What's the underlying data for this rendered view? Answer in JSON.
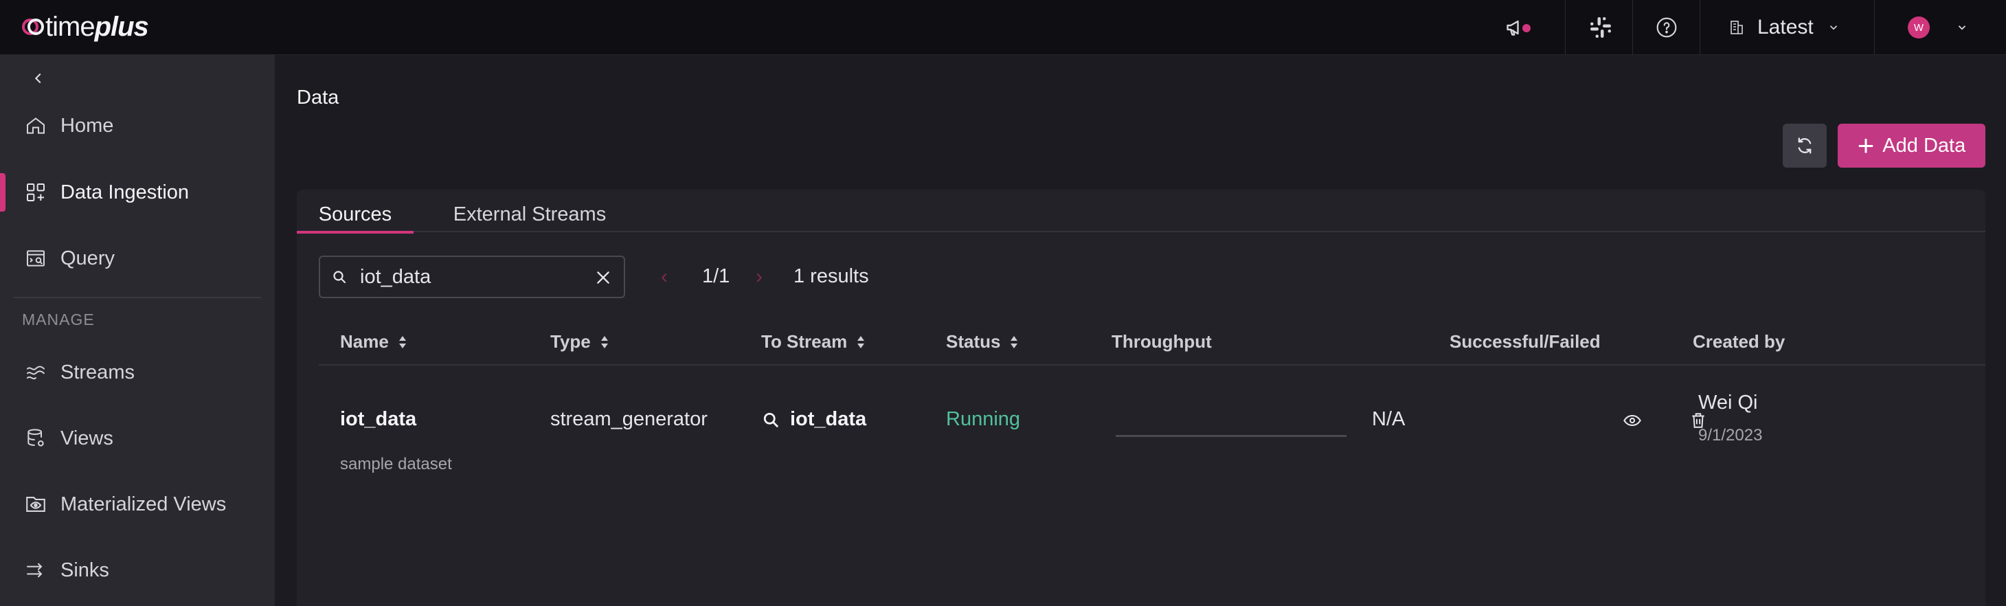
{
  "brand": {
    "logo_light": "time",
    "logo_bold": "plus"
  },
  "topbar": {
    "version_label": "Latest",
    "avatar_initial": "W"
  },
  "sidebar": {
    "items": [
      {
        "label": "Home",
        "icon": "home-icon"
      },
      {
        "label": "Data Ingestion",
        "icon": "data-ingestion-icon",
        "active": true
      },
      {
        "label": "Query",
        "icon": "query-icon"
      }
    ],
    "section_label": "MANAGE",
    "manage_items": [
      {
        "label": "Streams",
        "icon": "streams-icon"
      },
      {
        "label": "Views",
        "icon": "views-icon"
      },
      {
        "label": "Materialized Views",
        "icon": "materialized-views-icon"
      },
      {
        "label": "Sinks",
        "icon": "sinks-icon"
      }
    ]
  },
  "main": {
    "title": "Data",
    "add_label": "Add Data",
    "tabs": [
      {
        "label": "Sources",
        "active": true
      },
      {
        "label": "External Streams"
      }
    ],
    "search": {
      "value": "iot_data"
    },
    "pager": {
      "text": "1/1",
      "results": "1 results"
    },
    "columns": [
      "Name",
      "Type",
      "To Stream",
      "Status",
      "Throughput",
      "Successful/Failed",
      "Created by"
    ],
    "rows": [
      {
        "name": "iot_data",
        "description": "sample dataset",
        "type": "stream_generator",
        "to_stream": "iot_data",
        "status": "Running",
        "success_failed": "N/A",
        "created_by": "Wei Qi",
        "created_date": "9/1/2023"
      }
    ]
  },
  "colors": {
    "accent": "#d1367d",
    "status_running": "#4fc39a",
    "sidebar_bg": "#2a2930",
    "topbar_bg": "#0f0e12"
  }
}
